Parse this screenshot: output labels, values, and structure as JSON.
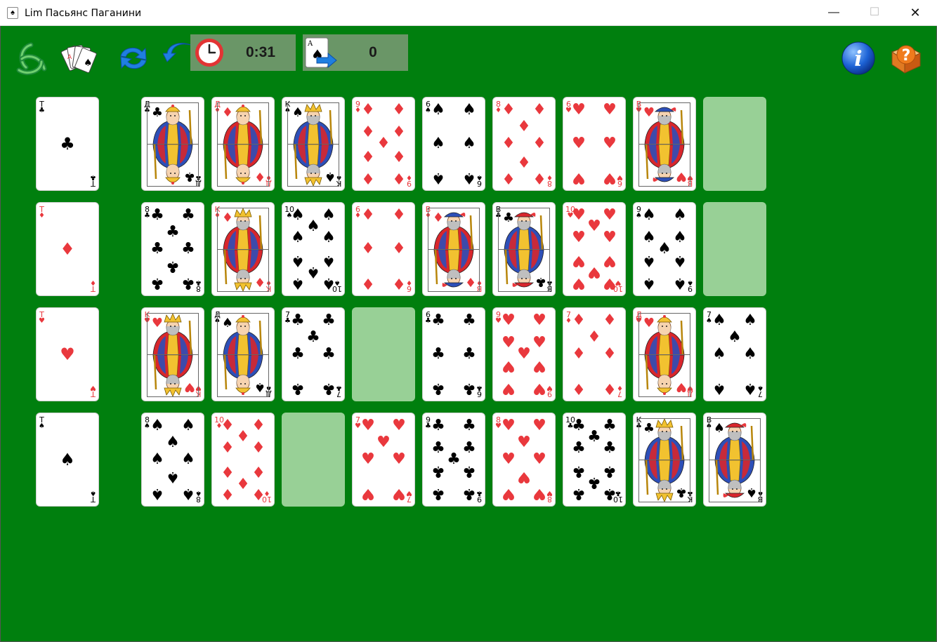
{
  "window": {
    "title": "Lim Пасьянс Паганини",
    "icon": "cards-app-icon",
    "minimize_glyph": "—",
    "maximize_glyph": "☐",
    "close_glyph": "✕"
  },
  "toolbar": {
    "icons": [
      "triskelion-menu-icon",
      "new-deal-cards-icon",
      "redeal-arrows-icon",
      "undo-arrow-icon",
      "info-icon",
      "help-book-icon"
    ],
    "timer": {
      "icon": "clock-icon",
      "value": "0:31"
    },
    "moves": {
      "icon": "card-move-icon",
      "icon_label": "A",
      "value": "0"
    }
  },
  "colors": {
    "felt": "#007f0e",
    "slot": "#98d096",
    "panel": "#6a9667",
    "red_suit": "#e9383d"
  },
  "board": {
    "aces": [
      {
        "rank": "Т",
        "suit": "♣",
        "color": "black"
      },
      {
        "rank": "Т",
        "suit": "♦",
        "color": "red"
      },
      {
        "rank": "Т",
        "suit": "♥",
        "color": "red"
      },
      {
        "rank": "Т",
        "suit": "♠",
        "color": "black"
      }
    ],
    "rows": [
      [
        {
          "rank": "Д",
          "suit": "♣",
          "face": true,
          "color": "black"
        },
        {
          "rank": "Д",
          "suit": "♦",
          "face": true,
          "color": "red"
        },
        {
          "rank": "К",
          "suit": "♠",
          "face": true,
          "color": "black"
        },
        {
          "rank": "9",
          "suit": "♦",
          "n": 9,
          "color": "red"
        },
        {
          "rank": "6",
          "suit": "♠",
          "n": 6,
          "color": "black"
        },
        {
          "rank": "8",
          "suit": "♦",
          "n": 8,
          "color": "red"
        },
        {
          "rank": "6",
          "suit": "♥",
          "n": 6,
          "color": "red"
        },
        {
          "rank": "В",
          "suit": "♥",
          "face": true,
          "color": "red"
        },
        {
          "empty": true
        }
      ],
      [
        {
          "rank": "8",
          "suit": "♣",
          "n": 8,
          "color": "black"
        },
        {
          "rank": "К",
          "suit": "♦",
          "face": true,
          "color": "red"
        },
        {
          "rank": "10",
          "suit": "♠",
          "n": 10,
          "color": "black"
        },
        {
          "rank": "6",
          "suit": "♦",
          "n": 6,
          "color": "red"
        },
        {
          "rank": "В",
          "suit": "♦",
          "face": true,
          "color": "red"
        },
        {
          "rank": "В",
          "suit": "♣",
          "face": true,
          "color": "black"
        },
        {
          "rank": "10",
          "suit": "♥",
          "n": 10,
          "color": "red"
        },
        {
          "rank": "9",
          "suit": "♠",
          "n": 9,
          "color": "black"
        },
        {
          "empty": true
        }
      ],
      [
        {
          "rank": "К",
          "suit": "♥",
          "face": true,
          "color": "red"
        },
        {
          "rank": "Д",
          "suit": "♠",
          "face": true,
          "color": "black"
        },
        {
          "rank": "7",
          "suit": "♣",
          "n": 7,
          "color": "black"
        },
        {
          "empty": true
        },
        {
          "rank": "6",
          "suit": "♣",
          "n": 6,
          "color": "black"
        },
        {
          "rank": "9",
          "suit": "♥",
          "n": 9,
          "color": "red"
        },
        {
          "rank": "7",
          "suit": "♦",
          "n": 7,
          "color": "red"
        },
        {
          "rank": "Д",
          "suit": "♥",
          "face": true,
          "color": "red"
        },
        {
          "rank": "7",
          "suit": "♠",
          "n": 7,
          "color": "black"
        }
      ],
      [
        {
          "rank": "8",
          "suit": "♠",
          "n": 8,
          "color": "black"
        },
        {
          "rank": "10",
          "suit": "♦",
          "n": 10,
          "color": "red"
        },
        {
          "empty": true
        },
        {
          "rank": "7",
          "suit": "♥",
          "n": 7,
          "color": "red"
        },
        {
          "rank": "9",
          "suit": "♣",
          "n": 9,
          "color": "black"
        },
        {
          "rank": "8",
          "suit": "♥",
          "n": 8,
          "color": "red"
        },
        {
          "rank": "10",
          "suit": "♣",
          "n": 10,
          "color": "black"
        },
        {
          "rank": "К",
          "suit": "♣",
          "face": true,
          "color": "black"
        },
        {
          "rank": "В",
          "suit": "♠",
          "face": true,
          "color": "black"
        }
      ]
    ]
  }
}
